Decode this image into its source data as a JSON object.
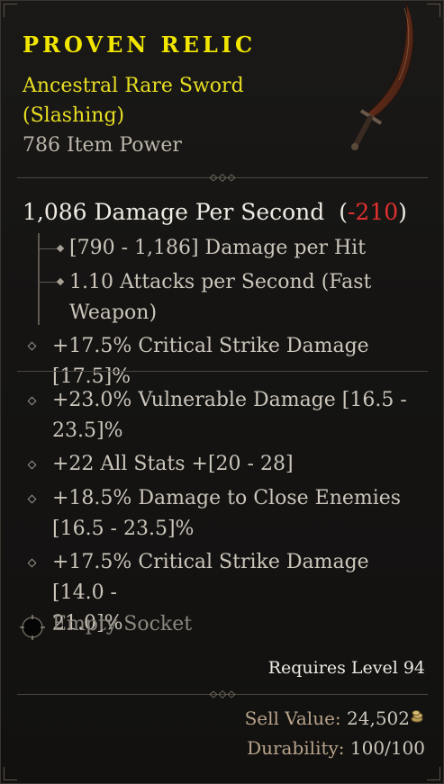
{
  "item": {
    "name": "PROVEN RELIC",
    "subtype_line1": "Ancestral Rare Sword",
    "subtype_line2": "(Slashing)",
    "item_power": "786 Item Power",
    "icon": "curved-sword-icon"
  },
  "damage": {
    "dps_text": "1,086 Damage Per Second",
    "open_paren": "(",
    "delta": "-210",
    "close_paren": ")",
    "per_hit": "[790 - 1,186] Damage per Hit",
    "attacks_line1": "1.10 Attacks per Second (Fast",
    "attacks_line2": "Weapon)",
    "implicit": "+17.5% Critical Strike Damage [17.5]%"
  },
  "affixes": [
    {
      "line1": "+23.0% Vulnerable Damage [16.5 -",
      "line2": "23.5]%"
    },
    {
      "line1": "+22 All Stats +[20 - 28]",
      "line2": ""
    },
    {
      "line1": "+18.5% Damage to Close Enemies",
      "line2": "[16.5 - 23.5]%"
    },
    {
      "line1": "+17.5% Critical Strike Damage [14.0 -",
      "line2": "21.0]%"
    }
  ],
  "socket": {
    "label": "Empty Socket",
    "icon": "empty-socket-icon"
  },
  "requirements": {
    "level_text": "Requires Level 94"
  },
  "footer": {
    "sell_label": "Sell Value:",
    "sell_value": "24,502",
    "sell_icon": "gold-coins-icon",
    "durability_label": "Durability:",
    "durability_value": "100/100"
  },
  "colors": {
    "rare_yellow": "#f2e600",
    "negative_red": "#e23030",
    "body_text": "#cbc5ba"
  }
}
